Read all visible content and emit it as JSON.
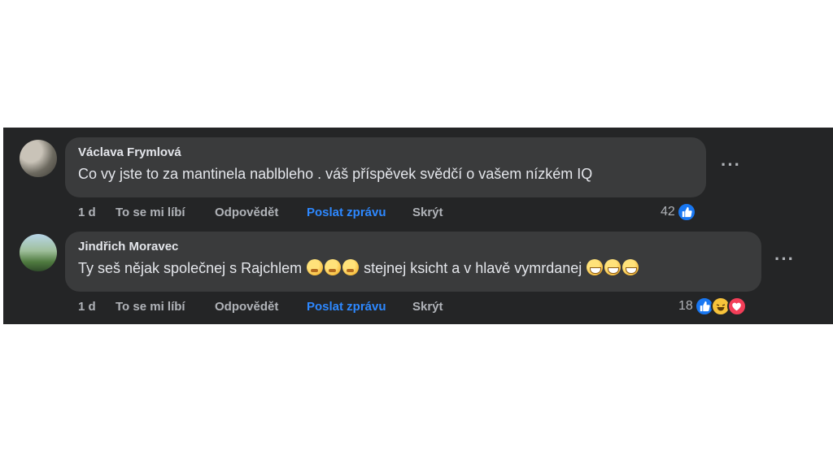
{
  "comments": [
    {
      "author": "Václava Frymlová",
      "text": "Co vy jste to za mantinela nablbleho . váš příspěvek svědčí o vašem nízkém IQ",
      "time": "1 d",
      "like_label": "To se mi líbí",
      "reply_label": "Odpovědět",
      "message_label": "Poslat zprávu",
      "hide_label": "Skrýt",
      "reaction_count": "42",
      "reaction_icons": [
        "like-icon"
      ]
    },
    {
      "author": "Jindřich Moravec",
      "text_part1": "Ty seš nějak společnej s Rajchlem",
      "text_part2": "stejnej ksicht a v hlavě vymrdanej",
      "emoji_group1": [
        "thinking-emoji",
        "thinking-emoji",
        "thinking-emoji"
      ],
      "emoji_group2": [
        "grinning-emoji",
        "grinning-emoji",
        "grinning-emoji"
      ],
      "time": "1 d",
      "like_label": "To se mi líbí",
      "reply_label": "Odpovědět",
      "message_label": "Poslat zprávu",
      "hide_label": "Skrýt",
      "reaction_count": "18",
      "reaction_icons": [
        "like-icon",
        "haha-icon",
        "love-icon"
      ]
    }
  ],
  "colors": {
    "panel_bg": "#242526",
    "bubble_bg": "#3a3b3c",
    "text": "#e4e6eb",
    "muted": "#b0b3b8",
    "link_blue": "#2d88ff",
    "like_blue": "#1877f2"
  }
}
